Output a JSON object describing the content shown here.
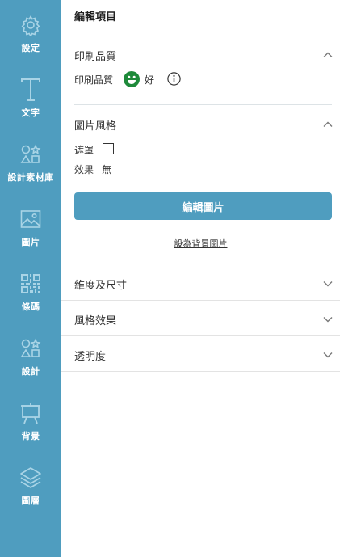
{
  "sidebar": {
    "bg_color": "#4f9dbf",
    "items": [
      {
        "label": "設定",
        "icon": "gear-icon"
      },
      {
        "label": "文字",
        "icon": "text-icon"
      },
      {
        "label": "設計素材庫",
        "icon": "shapes-icon"
      },
      {
        "label": "圖片",
        "icon": "image-icon"
      },
      {
        "label": "條碼",
        "icon": "qrcode-icon"
      },
      {
        "label": "設計",
        "icon": "shapes-icon"
      },
      {
        "label": "背景",
        "icon": "easel-icon"
      },
      {
        "label": "圖層",
        "icon": "layers-icon"
      }
    ]
  },
  "panel": {
    "title": "編輯項目",
    "print_quality": {
      "title": "印刷品質",
      "label": "印刷品質",
      "value": "好",
      "status_color": "#1e8a3a"
    },
    "image_style": {
      "title": "圖片風格",
      "mask_label": "遮罩",
      "mask_checked": false,
      "effect_label": "效果",
      "effect_value": "無"
    },
    "edit_button": "編輯圖片",
    "set_background_link": "設為背景圖片",
    "collapsed_sections": [
      {
        "title": "維度及尺寸"
      },
      {
        "title": "風格效果"
      },
      {
        "title": "透明度"
      }
    ]
  }
}
